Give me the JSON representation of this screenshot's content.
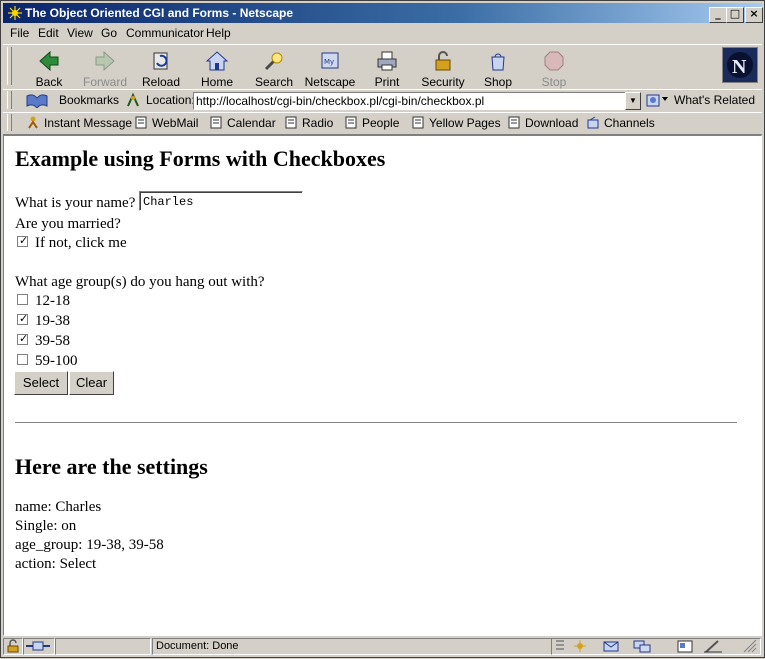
{
  "window": {
    "title": "The Object Oriented CGI and Forms - Netscape",
    "controls": {
      "minimize": "_",
      "maximize": "□",
      "close": "×"
    }
  },
  "menu": [
    "File",
    "Edit",
    "View",
    "Go",
    "Communicator",
    "Help"
  ],
  "nav_toolbar": {
    "buttons": [
      {
        "label": "Back",
        "icon": "back-arrow-icon",
        "enabled": true
      },
      {
        "label": "Forward",
        "icon": "forward-arrow-icon",
        "enabled": false
      },
      {
        "label": "Reload",
        "icon": "reload-icon",
        "enabled": true
      },
      {
        "label": "Home",
        "icon": "home-icon",
        "enabled": true
      },
      {
        "label": "Search",
        "icon": "search-icon",
        "enabled": true
      },
      {
        "label": "Netscape",
        "icon": "my-netscape-icon",
        "enabled": true
      },
      {
        "label": "Print",
        "icon": "print-icon",
        "enabled": true
      },
      {
        "label": "Security",
        "icon": "padlock-icon",
        "enabled": true
      },
      {
        "label": "Shop",
        "icon": "shop-bag-icon",
        "enabled": true
      },
      {
        "label": "Stop",
        "icon": "stop-icon",
        "enabled": false
      }
    ],
    "logo_letter": "N"
  },
  "location_toolbar": {
    "bookmarks_label": "Bookmarks",
    "location_label": "Location:",
    "url": "http://localhost/cgi-bin/checkbox.pl/cgi-bin/checkbox.pl",
    "whats_related_label": "What's Related"
  },
  "personal_toolbar": [
    {
      "label": "Instant Message",
      "icon": "instant-message-icon"
    },
    {
      "label": "WebMail",
      "icon": "bookmark-doc-icon"
    },
    {
      "label": "Calendar",
      "icon": "bookmark-doc-icon"
    },
    {
      "label": "Radio",
      "icon": "bookmark-doc-icon"
    },
    {
      "label": "People",
      "icon": "bookmark-doc-icon"
    },
    {
      "label": "Yellow Pages",
      "icon": "bookmark-doc-icon"
    },
    {
      "label": "Download",
      "icon": "bookmark-doc-icon"
    },
    {
      "label": "Channels",
      "icon": "channels-folder-icon"
    }
  ],
  "page": {
    "heading": "Example using Forms with Checkboxes",
    "name_label": "What is your name?",
    "name_value": "Charles",
    "married_label": "Are you married?",
    "married_checkbox": {
      "label": "If not, click me",
      "checked": true
    },
    "age_label": "What age group(s) do you hang out with?",
    "age_groups": [
      {
        "label": "12-18",
        "checked": false
      },
      {
        "label": "19-38",
        "checked": true
      },
      {
        "label": "39-58",
        "checked": true
      },
      {
        "label": "59-100",
        "checked": false
      }
    ],
    "select_button": "Select",
    "clear_button": "Clear",
    "settings_heading": "Here are the settings",
    "settings": [
      "name: Charles",
      "Single: on",
      "age_group: 19-38, 39-58",
      "action: Select"
    ]
  },
  "status": {
    "text": "Document: Done"
  }
}
